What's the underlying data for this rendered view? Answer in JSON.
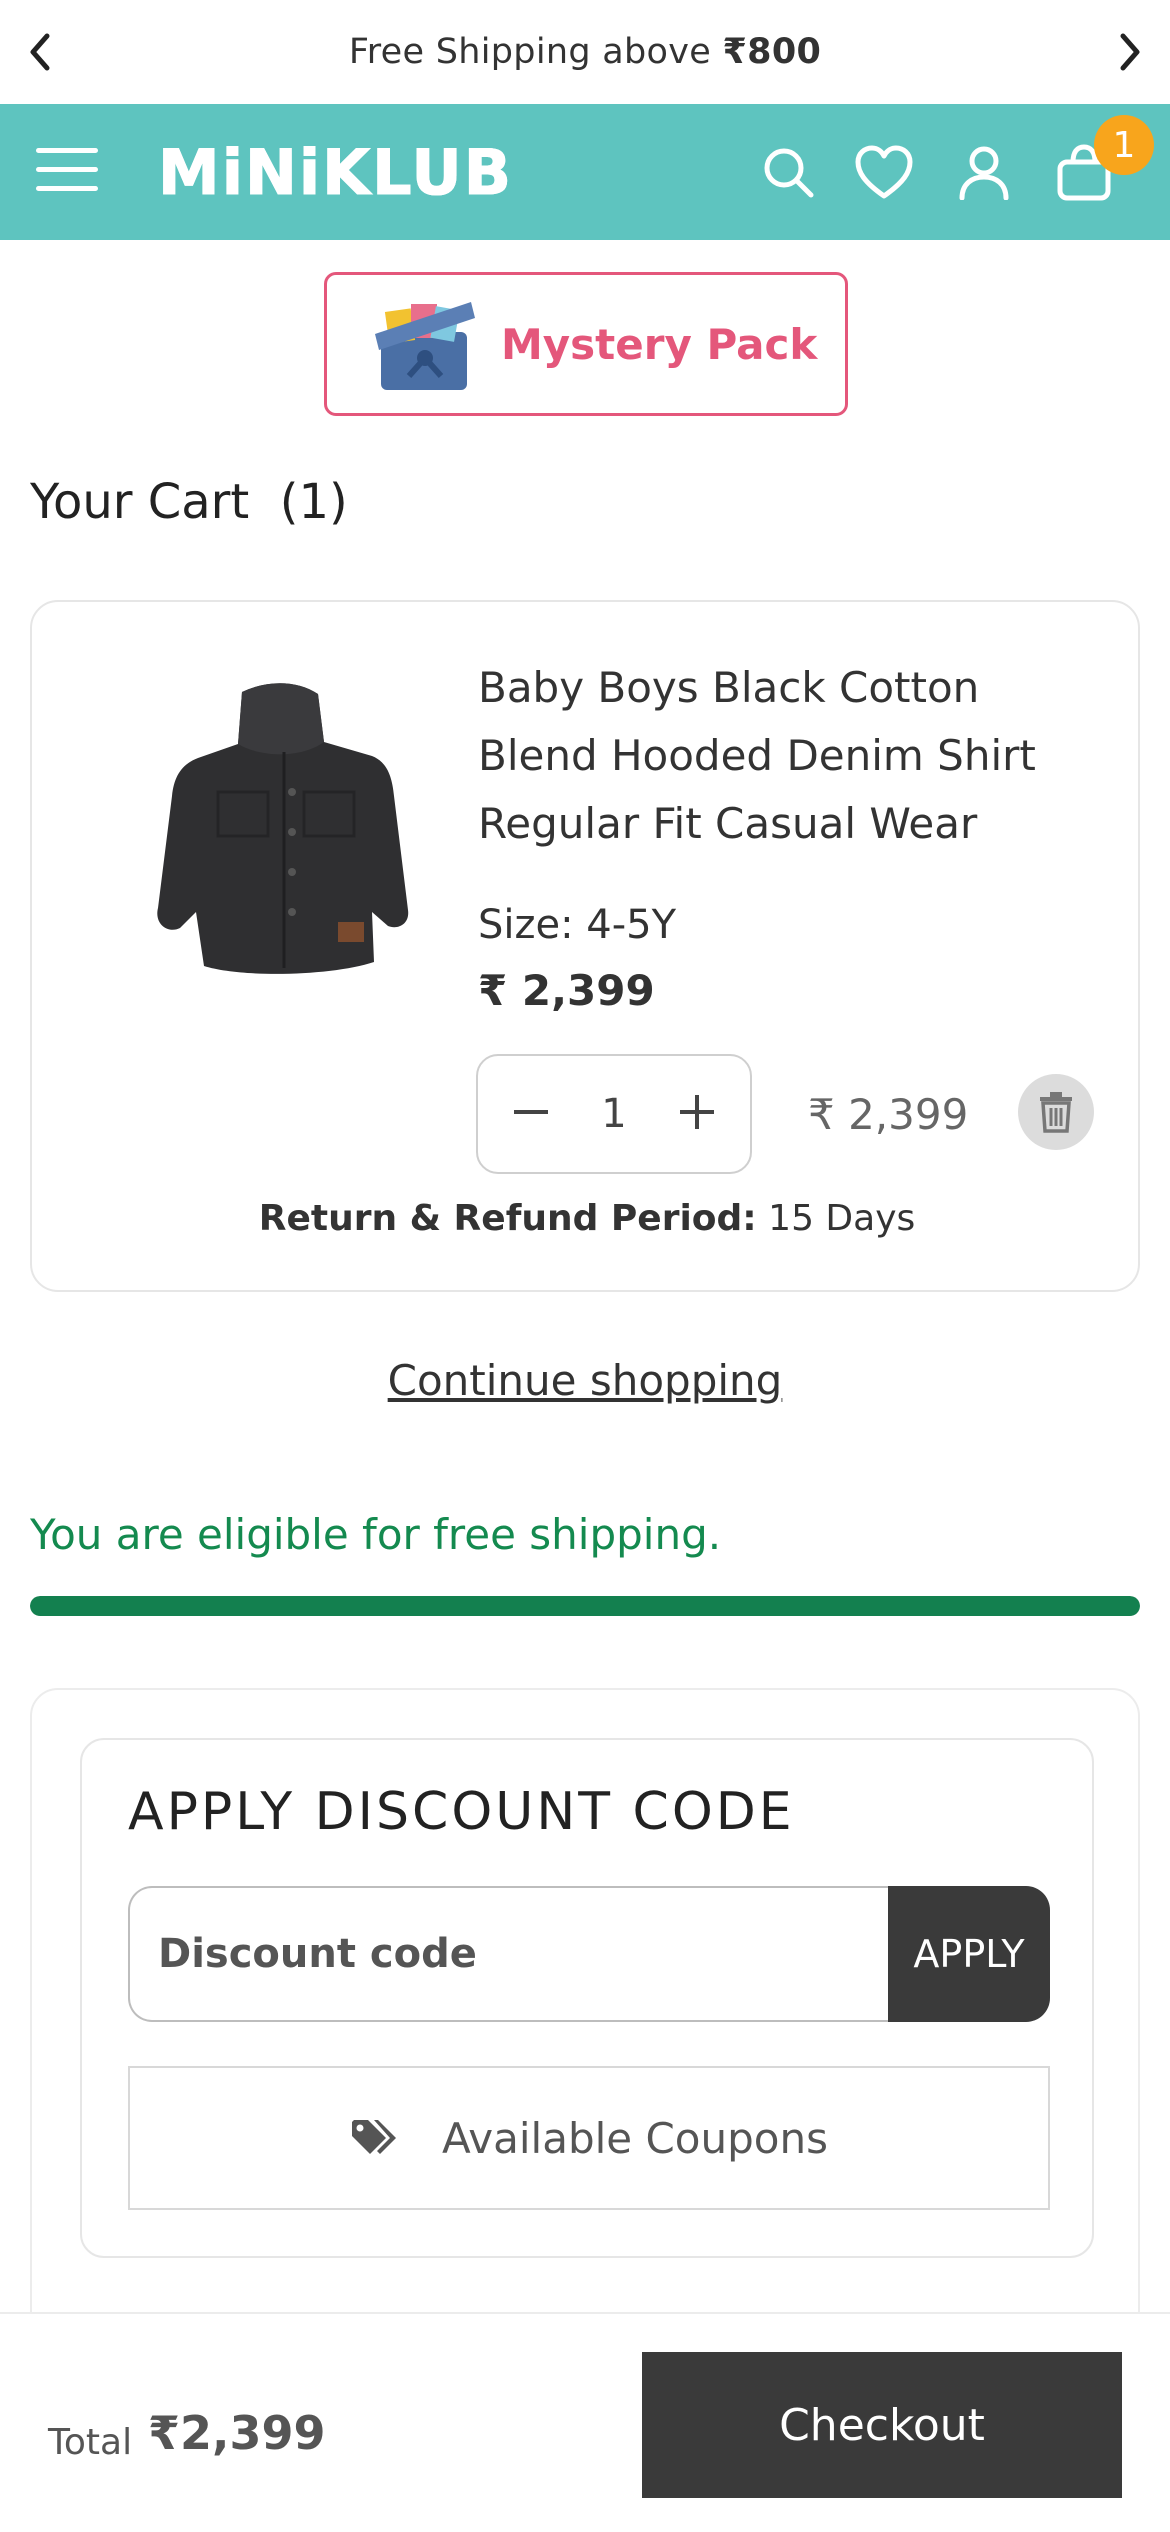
{
  "announcement": {
    "text_prefix": "Free Shipping above ",
    "amount": "₹800"
  },
  "header": {
    "logo": "MiNiKLUB",
    "cart_count": "1"
  },
  "promo": {
    "label": "Mystery Pack"
  },
  "cart": {
    "title": "Your Cart",
    "count": "(1)",
    "item": {
      "name": "Baby Boys Black Cotton Blend Hooded Denim Shirt Regular Fit Casual Wear",
      "size": "Size: 4-5Y",
      "price": "₹ 2,399",
      "quantity": "1",
      "line_total": "₹ 2,399",
      "refund_label": "Return & Refund Period:",
      "refund_value": " 15 Days"
    },
    "continue_label": "Continue shopping"
  },
  "shipping": {
    "message": "You are eligible for free shipping.",
    "progress": 1.0,
    "color": "#13804f"
  },
  "discount": {
    "title": "APPLY DISCOUNT CODE",
    "placeholder": "Discount code",
    "apply_label": "APPLY",
    "coupons_label": "Available Coupons"
  },
  "footer": {
    "total_label": "Total",
    "total_value": "₹2,399",
    "checkout_label": "Checkout"
  },
  "colors": {
    "header_bg": "#5ec4bf",
    "badge": "#f8a51c",
    "promo_accent": "#e4577b",
    "dark_button": "#3a3a3a"
  }
}
